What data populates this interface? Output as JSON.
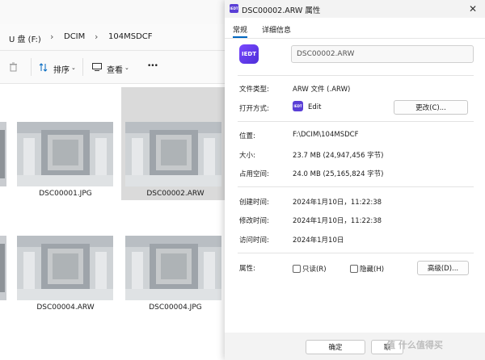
{
  "explorer": {
    "breadcrumbs": [
      "U 盘 (F:)",
      "DCIM",
      "104MSDCF"
    ],
    "toolbar": {
      "sort_label": "排序",
      "view_label": "查看",
      "more_label": "•••"
    },
    "files": [
      {
        "name": "DSC00001.JPG",
        "selected": false
      },
      {
        "name": "DSC00002.ARW",
        "selected": true
      },
      {
        "name": "DSC00004.ARW",
        "selected": false
      },
      {
        "name": "DSC00004.JPG",
        "selected": false
      }
    ]
  },
  "dialog": {
    "title": "DSC00002.ARW 属性",
    "app_icon": "IEDT",
    "tabs": [
      "常规",
      "详细信息"
    ],
    "active_tab": "常规",
    "file_name": "DSC00002.ARW",
    "rows": {
      "type": {
        "label": "文件类型:",
        "value": "ARW 文件 (.ARW)"
      },
      "opens_with": {
        "label": "打开方式:",
        "value": "Edit",
        "button": "更改(C)..."
      },
      "location": {
        "label": "位置:",
        "value": "F:\\DCIM\\104MSDCF"
      },
      "size": {
        "label": "大小:",
        "value": "23.7 MB (24,947,456 字节)"
      },
      "size_on_disk": {
        "label": "占用空间:",
        "value": "24.0 MB (25,165,824 字节)"
      },
      "created": {
        "label": "创建时间:",
        "value": "2024年1月10日，11:22:38"
      },
      "modified": {
        "label": "修改时间:",
        "value": "2024年1月10日，11:22:38"
      },
      "accessed": {
        "label": "访问时间:",
        "value": "2024年1月10日"
      },
      "attributes": {
        "label": "属性:",
        "readonly": "只读(R)",
        "hidden": "隐藏(H)",
        "advanced": "高级(D)..."
      }
    },
    "footer": {
      "ok_label": "确定",
      "cancel_label": "取"
    }
  },
  "watermark": "值 什么值得买",
  "colors": {
    "accent": "#0067c0",
    "app_icon": "#5a3fd6"
  }
}
